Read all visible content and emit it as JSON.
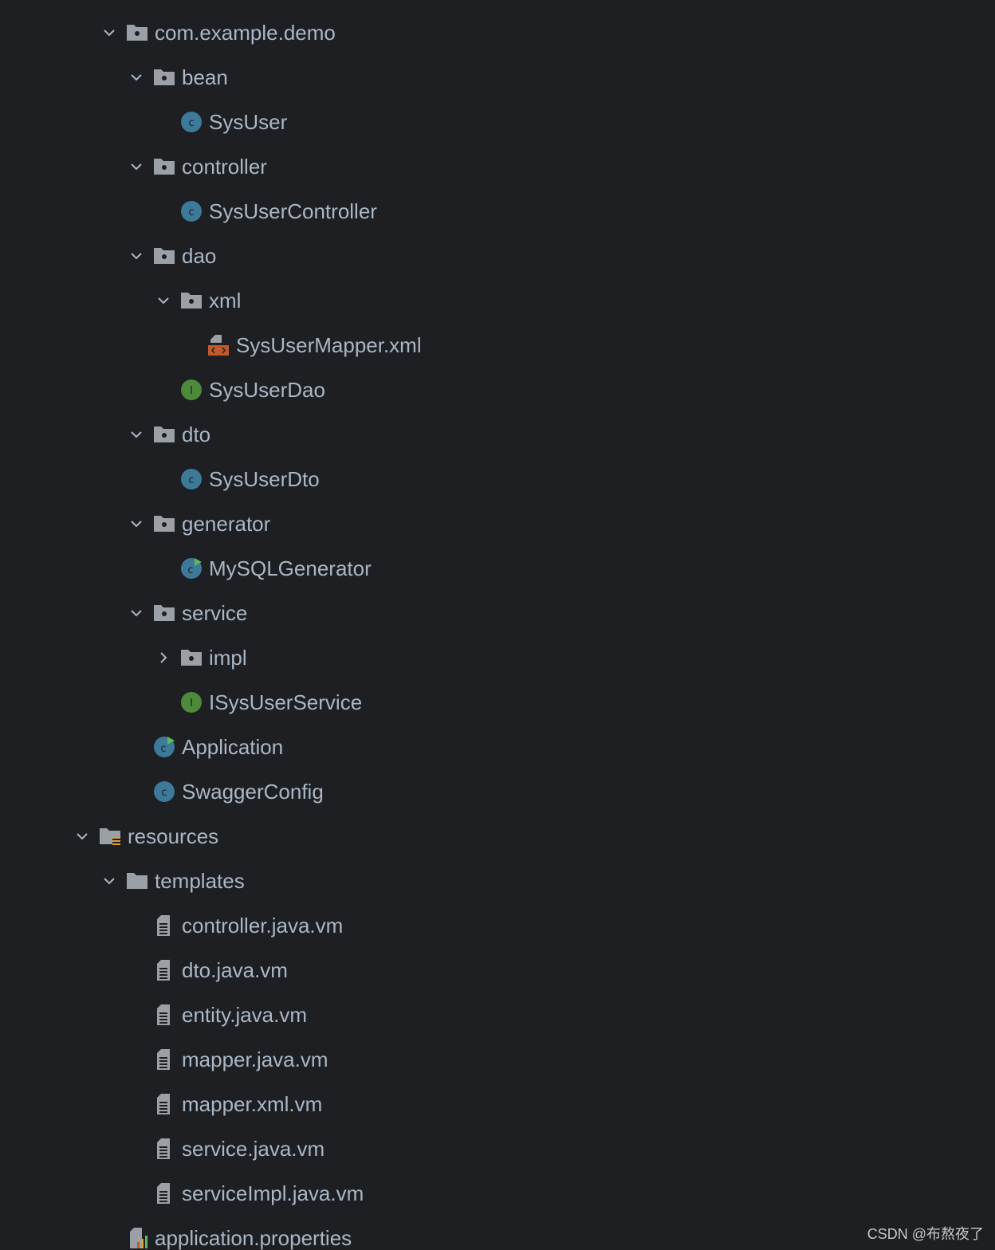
{
  "tree": {
    "root": {
      "label": "com.example.demo",
      "icon": "package-icon"
    },
    "pkg_bean": {
      "label": "bean",
      "icon": "package-icon"
    },
    "sysuser": {
      "label": "SysUser",
      "icon": "class-icon"
    },
    "pkg_controller": {
      "label": "controller",
      "icon": "package-icon"
    },
    "sysusercontroller": {
      "label": "SysUserController",
      "icon": "class-icon"
    },
    "pkg_dao": {
      "label": "dao",
      "icon": "package-icon"
    },
    "pkg_xml": {
      "label": "xml",
      "icon": "package-icon"
    },
    "sysusermapper_xml": {
      "label": "SysUserMapper.xml",
      "icon": "xml-file-icon"
    },
    "sysuserdao": {
      "label": "SysUserDao",
      "icon": "interface-icon"
    },
    "pkg_dto": {
      "label": "dto",
      "icon": "package-icon"
    },
    "sysuserdto": {
      "label": "SysUserDto",
      "icon": "class-icon"
    },
    "pkg_generator": {
      "label": "generator",
      "icon": "package-icon"
    },
    "mysqlgenerator": {
      "label": "MySQLGenerator",
      "icon": "runnable-class-icon"
    },
    "pkg_service": {
      "label": "service",
      "icon": "package-icon"
    },
    "pkg_impl": {
      "label": "impl",
      "icon": "package-icon"
    },
    "isysuserservice": {
      "label": "ISysUserService",
      "icon": "interface-icon"
    },
    "application": {
      "label": "Application",
      "icon": "runnable-class-icon"
    },
    "swaggerconfig": {
      "label": "SwaggerConfig",
      "icon": "class-icon"
    },
    "resources": {
      "label": "resources",
      "icon": "resources-folder-icon"
    },
    "templates": {
      "label": "templates",
      "icon": "folder-icon"
    },
    "controller_vm": {
      "label": "controller.java.vm",
      "icon": "text-file-icon"
    },
    "dto_vm": {
      "label": "dto.java.vm",
      "icon": "text-file-icon"
    },
    "entity_vm": {
      "label": "entity.java.vm",
      "icon": "text-file-icon"
    },
    "mapper_java_vm": {
      "label": "mapper.java.vm",
      "icon": "text-file-icon"
    },
    "mapper_xml_vm": {
      "label": "mapper.xml.vm",
      "icon": "text-file-icon"
    },
    "service_vm": {
      "label": "service.java.vm",
      "icon": "text-file-icon"
    },
    "serviceimpl_vm": {
      "label": "serviceImpl.java.vm",
      "icon": "text-file-icon"
    },
    "app_properties": {
      "label": "application.properties",
      "icon": "properties-file-icon"
    }
  },
  "colors": {
    "background": "#1e1f22",
    "text": "#a9b7c6",
    "class_blue": "#3d7a9a",
    "interface_green": "#4e8a3b",
    "run_green": "#5fb85f",
    "xml_orange": "#c05a2a",
    "folder_gray": "#9aa0a6"
  },
  "watermark": "CSDN @布熬夜了"
}
